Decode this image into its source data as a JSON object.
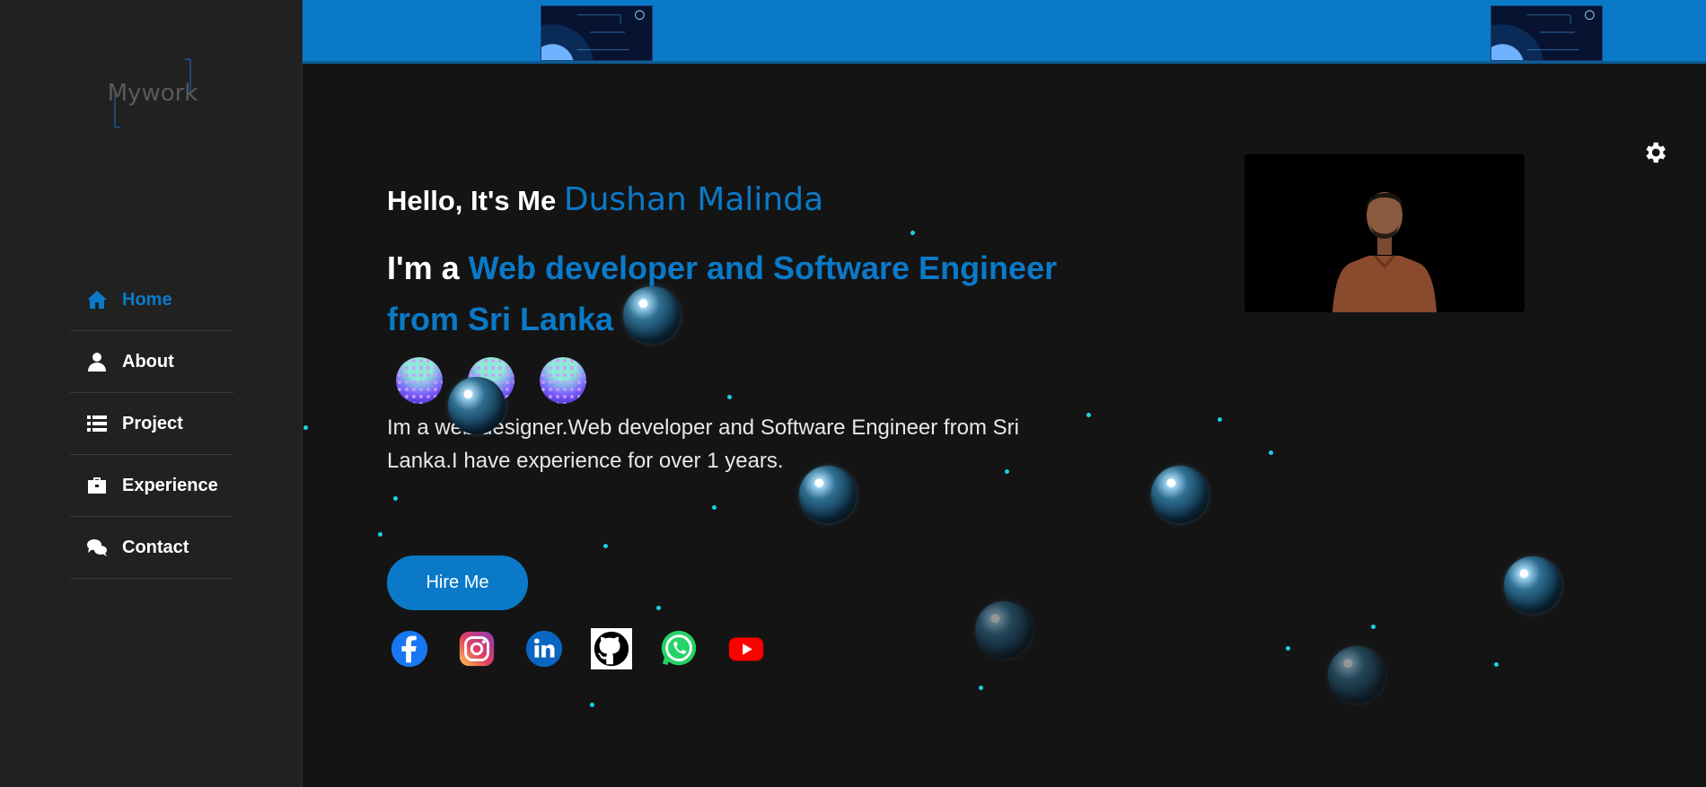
{
  "sidebar": {
    "logo_text": "Mywork",
    "items": [
      {
        "label": "Home",
        "icon": "home-icon",
        "active": true
      },
      {
        "label": "About",
        "icon": "user-icon",
        "active": false
      },
      {
        "label": "Project",
        "icon": "list-icon",
        "active": false
      },
      {
        "label": "Experience",
        "icon": "briefcase-icon",
        "active": false
      },
      {
        "label": "Contact",
        "icon": "chat-icon",
        "active": false
      }
    ]
  },
  "hero": {
    "greeting": "Hello, It's Me ",
    "name": "Dushan Malinda",
    "role_prefix": "I'm a ",
    "role": "Web developer and Software Engineer from Sri Lanka",
    "description": "Im a web designer.Web developer and Software Engineer from Sri Lanka.I have experience for over 1 years.",
    "hire_button": "Hire Me"
  },
  "socials": [
    {
      "name": "Facebook",
      "icon": "facebook-icon"
    },
    {
      "name": "Instagram",
      "icon": "instagram-icon"
    },
    {
      "name": "LinkedIn",
      "icon": "linkedin-icon"
    },
    {
      "name": "GitHub",
      "icon": "github-icon"
    },
    {
      "name": "WhatsApp",
      "icon": "whatsapp-icon"
    },
    {
      "name": "YouTube",
      "icon": "youtube-icon"
    }
  ],
  "colors": {
    "accent": "#0a7ac8",
    "sidebar_bg": "#212121",
    "page_bg": "#141414",
    "spark": "#19d3e6"
  },
  "theme_toggle_icon": "gear-icon"
}
